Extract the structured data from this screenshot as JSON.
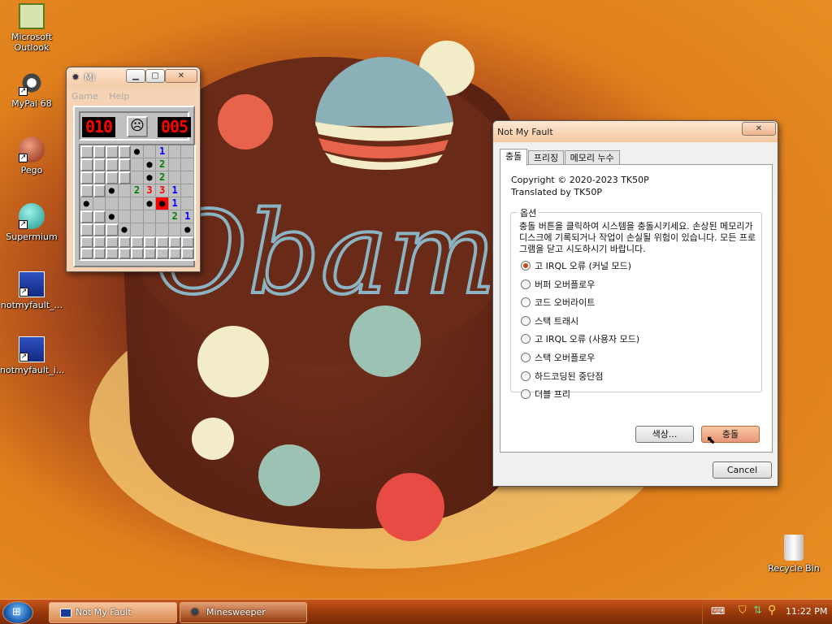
{
  "desktop": {
    "icons": [
      {
        "label": "Microsoft\nOutlook",
        "icon": "outlook-icon"
      },
      {
        "label": "MyPal 68",
        "icon": "raccoon-icon"
      },
      {
        "label": "Pego",
        "icon": "pego-icon"
      },
      {
        "label": "Supermium",
        "icon": "supermium-icon"
      },
      {
        "label": "notmyfault_...",
        "icon": "shortcut-window-icon"
      },
      {
        "label": "notmyfault_i...",
        "icon": "shortcut-window-icon"
      },
      {
        "label": "Recycle Bin",
        "icon": "recycle-bin-icon"
      }
    ],
    "wallpaper_text": "Obama"
  },
  "minesweeper": {
    "title": "Mi",
    "menu": [
      "Game",
      "Help"
    ],
    "mine_counter": "010",
    "timer": "005",
    "face": "☹",
    "grid": [
      [
        "",
        "",
        "",
        "",
        "*",
        "",
        "1",
        "",
        ""
      ],
      [
        "",
        "",
        "",
        "",
        "",
        "*",
        "2",
        "",
        ""
      ],
      [
        "",
        "",
        "",
        "",
        "",
        "*",
        "2",
        "",
        ""
      ],
      [
        "",
        "",
        "*",
        "",
        "2",
        "3",
        "3",
        "1",
        ""
      ],
      [
        "*",
        "",
        "",
        "",
        "",
        "*",
        "X",
        "1",
        ""
      ],
      [
        "",
        "",
        "*",
        "",
        "",
        "",
        "",
        "2",
        "1"
      ],
      [
        "",
        "",
        "",
        "*",
        "",
        "",
        "",
        "",
        "*"
      ],
      [
        "",
        "",
        "",
        "",
        "",
        "",
        "",
        "",
        ""
      ],
      [
        "",
        "",
        "",
        "",
        "",
        "",
        "",
        "",
        ""
      ]
    ],
    "open": [
      [
        0,
        0,
        0,
        0,
        1,
        1,
        1,
        1,
        1
      ],
      [
        0,
        0,
        0,
        0,
        1,
        1,
        1,
        1,
        1
      ],
      [
        0,
        0,
        0,
        0,
        1,
        1,
        1,
        1,
        1
      ],
      [
        0,
        0,
        1,
        1,
        1,
        1,
        1,
        1,
        1
      ],
      [
        1,
        1,
        1,
        1,
        1,
        1,
        1,
        1,
        1
      ],
      [
        0,
        0,
        1,
        1,
        1,
        1,
        1,
        1,
        1
      ],
      [
        0,
        0,
        0,
        1,
        1,
        1,
        1,
        1,
        1
      ],
      [
        0,
        0,
        0,
        0,
        0,
        0,
        0,
        0,
        0
      ],
      [
        0,
        0,
        0,
        0,
        0,
        0,
        0,
        0,
        0
      ]
    ]
  },
  "notmyfault": {
    "title": "Not My Fault",
    "tabs": [
      "충돌",
      "프리징",
      "메모리 누수"
    ],
    "copyright": "Copyright © 2020-2023 TK50P",
    "translated": "Translated by TK50P",
    "group_label": "옵션",
    "description": "충돌 버튼을 클릭하여 시스템을 충돌시키세요. 손상된 메모리가 디스크에 기록되거나 작업이 손실될 위험이 있습니다. 모든 프로그램을 닫고 시도하시기 바랍니다.",
    "options": [
      "고 IRQL 오류 (커널 모드)",
      "버퍼 오버플로우",
      "코드 오버라이트",
      "스택 트래시",
      "고 IRQL 오류 (사용자 모드)",
      "스택 오버플로우",
      "하드코딩된 중단점",
      "더블 프리"
    ],
    "selected_option": 0,
    "color_button": "색상...",
    "crash_button": "충돌",
    "cancel_button": "Cancel"
  },
  "taskbar": {
    "items": [
      "Not My Fault",
      "Minesweeper"
    ],
    "clock": "11:22 PM"
  }
}
